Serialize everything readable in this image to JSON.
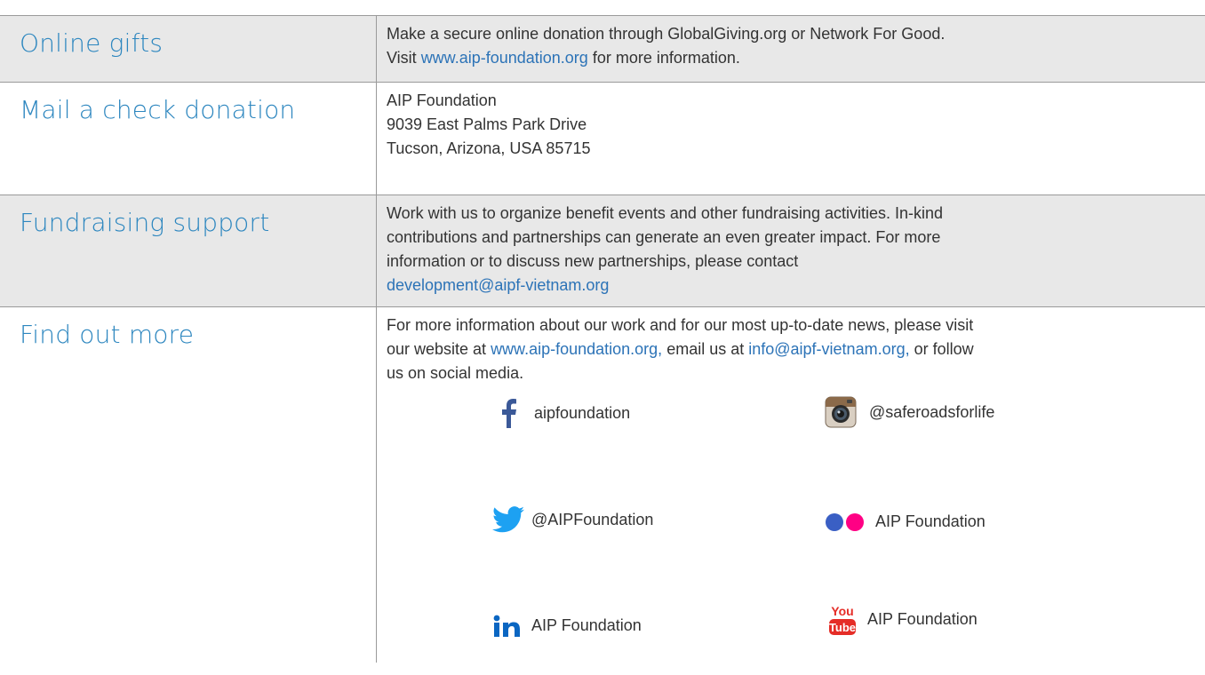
{
  "rows": [
    {
      "heading": "Online gifts",
      "lines": [
        [
          {
            "t": "Make a secure online donation through GlobalGiving.org or Network For Good."
          }
        ],
        [
          {
            "t": "Visit "
          },
          {
            "t": "www.aip-foundation.org",
            "link": true
          },
          {
            "t": " for more information."
          }
        ]
      ]
    },
    {
      "heading": "Mail a check donation",
      "lines": [
        [
          {
            "t": "AIP Foundation"
          }
        ],
        [
          {
            "t": "9039 East Palms Park Drive"
          }
        ],
        [
          {
            "t": "Tucson, Arizona, USA 85715"
          }
        ]
      ]
    },
    {
      "heading": "Fundraising support",
      "lines": [
        [
          {
            "t": "Work with us to organize benefit events and other fundraising activities. In-kind"
          }
        ],
        [
          {
            "t": "contributions and partnerships can generate an even greater impact. For more"
          }
        ],
        [
          {
            "t": "information or to discuss new partnerships, please contact"
          }
        ],
        [
          {
            "t": "development@aipf-vietnam.org",
            "link": true
          }
        ]
      ]
    },
    {
      "heading": "Find out more",
      "lines": [
        [
          {
            "t": "For more information about our work and for our most up-to-date news, please visit"
          }
        ],
        [
          {
            "t": "our website at "
          },
          {
            "t": "www.aip-foundation.org,",
            "link": true
          },
          {
            "t": " email us at "
          },
          {
            "t": "info@aipf-vietnam.org,",
            "link": true
          },
          {
            "t": " or follow"
          }
        ],
        [
          {
            "t": "us on social media."
          }
        ]
      ]
    }
  ],
  "social": {
    "facebook": {
      "label": "aipfoundation",
      "icon": "facebook-icon",
      "color": "#3b5998"
    },
    "instagram": {
      "label": "@saferoadsforlife",
      "icon": "instagram-icon"
    },
    "twitter": {
      "label": "@AIPFoundation",
      "icon": "twitter-icon",
      "color": "#1da1f2"
    },
    "flickr": {
      "label": "AIP Foundation",
      "icon": "flickr-icon",
      "colors": [
        "#3a5fc4",
        "#ff0084"
      ]
    },
    "linkedin": {
      "label": "AIP Foundation",
      "icon": "linkedin-icon",
      "color": "#0a66c2"
    },
    "youtube": {
      "label": "AIP Foundation",
      "icon": "youtube-icon",
      "color": "#e52d27",
      "badge_top": "You",
      "badge_bottom": "Tube"
    }
  },
  "colors": {
    "heading": "#2c86bf",
    "link": "#2c73b7",
    "shade": "#e8e8e8",
    "rule": "#9a9a9a"
  }
}
